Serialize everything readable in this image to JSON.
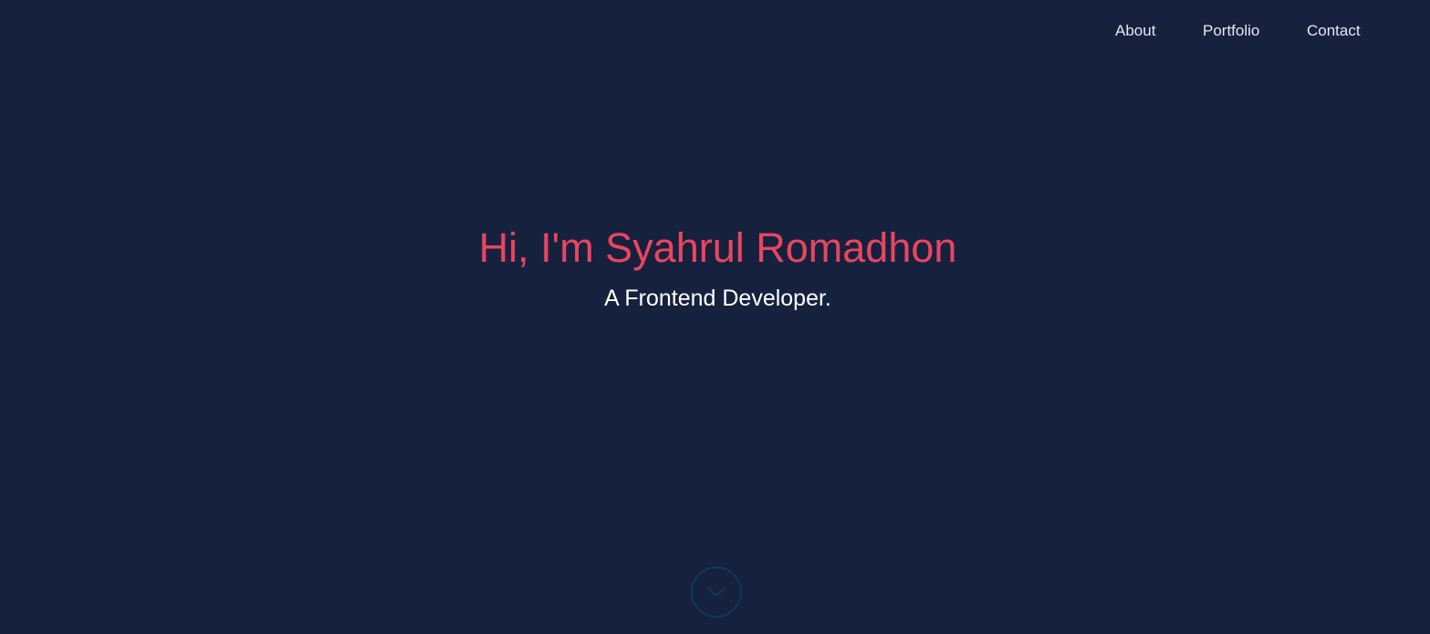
{
  "nav": {
    "items": [
      {
        "label": "About"
      },
      {
        "label": "Portfolio"
      },
      {
        "label": "Contact"
      }
    ]
  },
  "hero": {
    "title": "Hi, I'm Syahrul Romadhon",
    "subtitle": "A Frontend Developer."
  },
  "scroll_button": {
    "icon": "chevron-down-icon"
  },
  "colors": {
    "background": "#16213e",
    "accent": "#e94560",
    "text": "#ffffff",
    "scroll_ring": "#0f3a4f"
  }
}
